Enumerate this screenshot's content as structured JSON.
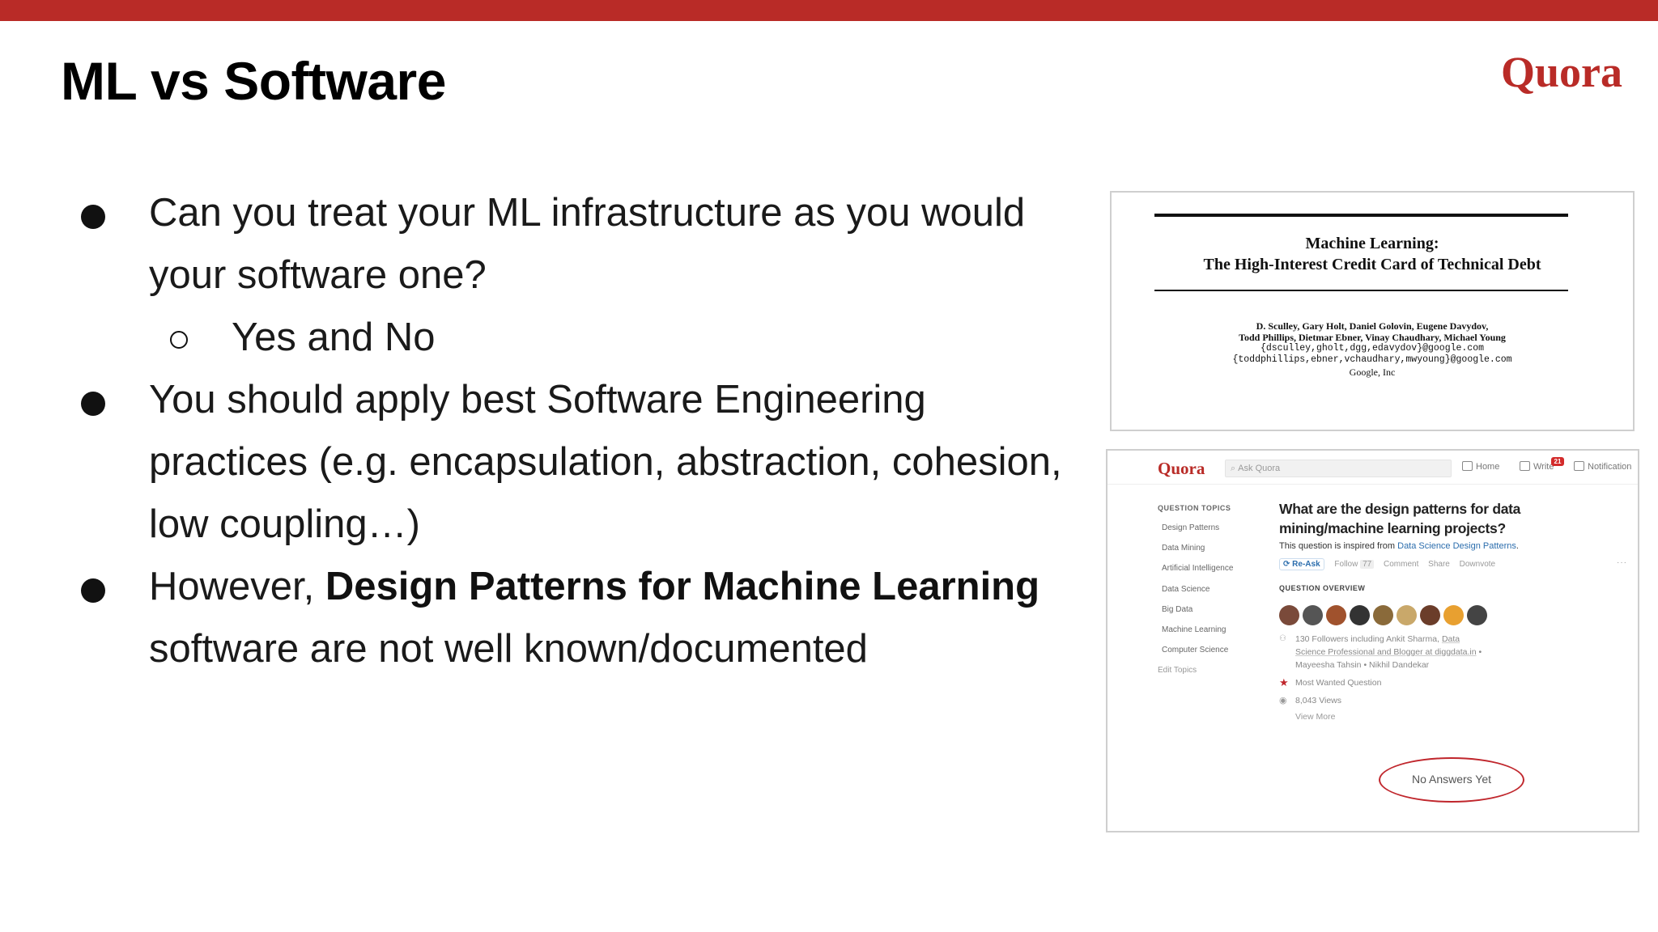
{
  "slide": {
    "title": "ML vs Software",
    "brand": "Quora",
    "accent_color": "#b92b27"
  },
  "bullets": {
    "b1_line1": "Can you treat your ML infrastructure as you would",
    "b1_line2": "your software one?",
    "b1_sub": "Yes and No",
    "b2_line1": "You should apply best Software Engineering",
    "b2_line2": "practices (e.g. encapsulation, abstraction, cohesion,",
    "b2_line3": "low coupling…)",
    "b3_prefix": "However, ",
    "b3_bold": "Design Patterns for Machine Learning",
    "b3_line2": "software are not well known/documented"
  },
  "paper": {
    "title_line1": "Machine Learning:",
    "title_line2": "The High-Interest Credit Card of Technical Debt",
    "authors_line1": "D. Sculley, Gary Holt, Daniel Golovin, Eugene Davydov,",
    "authors_line2": "Todd Phillips, Dietmar Ebner, Vinay Chaudhary, Michael Young",
    "emails_line1": "{dsculley,gholt,dgg,edavydov}@google.com",
    "emails_line2": "{toddphillips,ebner,vchaudhary,mwyoung}@google.com",
    "affiliation": "Google, Inc"
  },
  "quora": {
    "logo": "Quora",
    "search_placeholder": "Ask Quora",
    "nav_home": "Home",
    "nav_write": "Write",
    "nav_write_badge": "21",
    "nav_notifications": "Notification",
    "topics_heading": "QUESTION TOPICS",
    "topics": [
      "Design Patterns",
      "Data Mining",
      "Artificial Intelligence",
      "Data Science",
      "Big Data",
      "Machine Learning",
      "Computer Science"
    ],
    "edit_topics": "Edit Topics",
    "question_line1": "What are the design patterns for data",
    "question_line2": "mining/machine learning projects?",
    "inspired_prefix": "This question is inspired from ",
    "inspired_link": "Data Science Design Patterns",
    "inspired_suffix": ".",
    "reask": "Re-Ask",
    "follow": "Follow",
    "follow_count": "77",
    "comment": "Comment",
    "share": "Share",
    "downvote": "Downvote",
    "more": "···",
    "overview_heading": "QUESTION OVERVIEW",
    "followers_line1_prefix": "130 Followers including Ankit Sharma, ",
    "followers_line1_link": "Data",
    "followers_line2_link": "Science Professional and Blogger at diggdata.in",
    "followers_line2_suffix": " •",
    "followers_line3": "Mayeesha Tahsin • Nikhil Dandekar",
    "most_wanted": "Most Wanted Question",
    "views": "8,043 Views",
    "view_more": "View More",
    "no_answers": "No Answers Yet",
    "avatar_colors": [
      "#7a4a3a",
      "#555555",
      "#a0522d",
      "#333333",
      "#8a6a3a",
      "#c9a86a",
      "#6b3d2a",
      "#e8a030",
      "#444444"
    ]
  }
}
